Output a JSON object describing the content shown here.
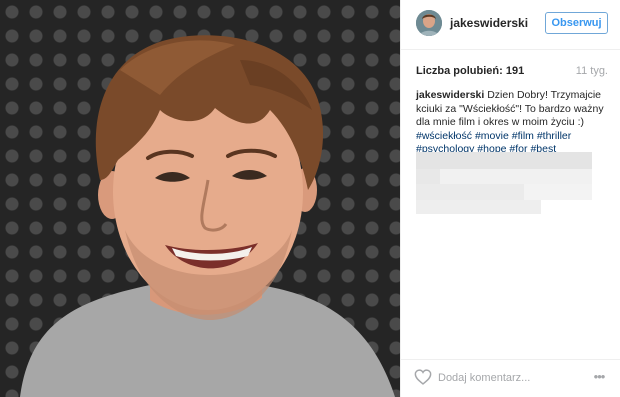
{
  "post": {
    "photo": {
      "alt": "selfie",
      "icon": "photo"
    }
  },
  "header": {
    "username": "jakeswiderski",
    "follow_label": "Obserwuj",
    "accent": "#3897f0"
  },
  "stats": {
    "likes": "Liczba polubień: 191",
    "time": "11 tyg."
  },
  "caption": {
    "username": "jakeswiderski",
    "text": " Dzien Dobry! Trzymajcie kciuki za \"Wściekłość\"! To bardzo ważny dla mnie film i okres w moim życiu :)",
    "hashtags": [
      "#wściekłość",
      "#movie",
      "#film",
      "#thriller",
      "#psychology",
      "#hope",
      "#for",
      "#best"
    ]
  },
  "footer": {
    "comment_placeholder": "Dodaj komentarz...",
    "like_icon": "heart-icon",
    "more_icon": "more-options-icon",
    "more_glyph": "•••"
  }
}
